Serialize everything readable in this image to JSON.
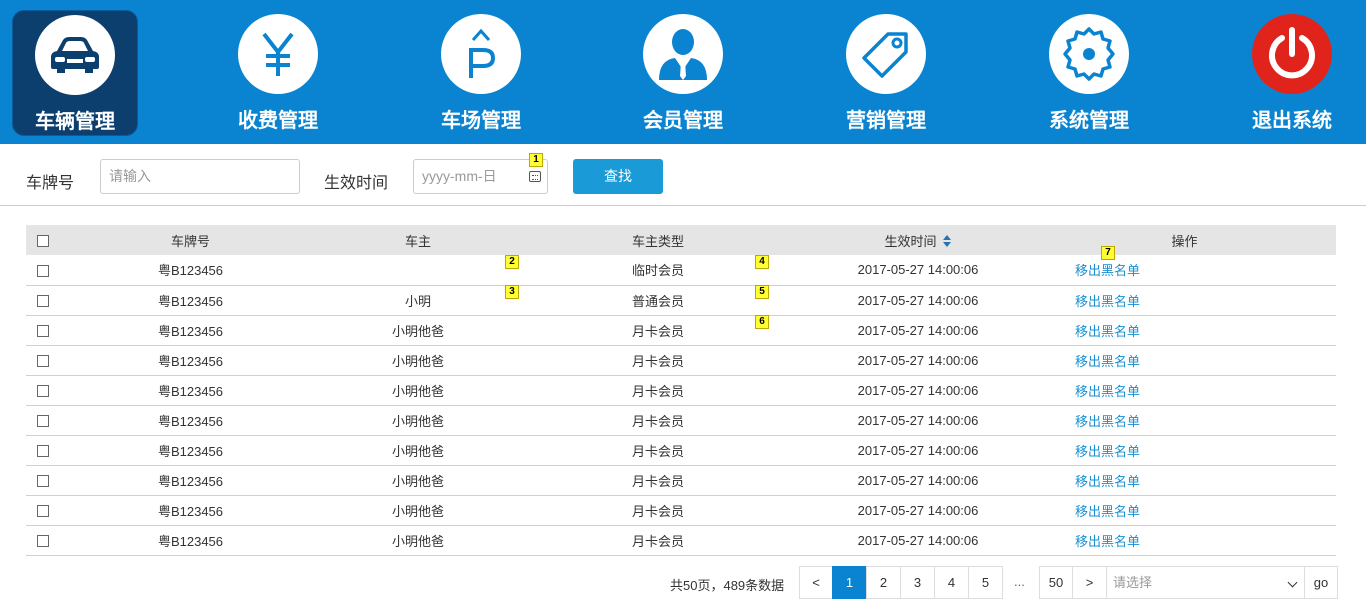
{
  "nav": {
    "items": [
      {
        "label": "车辆管理",
        "icon": "car-icon",
        "active": true
      },
      {
        "label": "收费管理",
        "icon": "yen-icon"
      },
      {
        "label": "车场管理",
        "icon": "parking-icon"
      },
      {
        "label": "会员管理",
        "icon": "member-icon"
      },
      {
        "label": "营销管理",
        "icon": "tag-icon"
      },
      {
        "label": "系统管理",
        "icon": "gear-icon"
      },
      {
        "label": "退出系统",
        "icon": "power-icon"
      }
    ],
    "colors": {
      "bar": "#0a84d0",
      "active": "#0c3f6e",
      "exit": "#e0241b"
    }
  },
  "search": {
    "plate_label": "车牌号",
    "plate_placeholder": "请输入",
    "date_label": "生效时间",
    "date_placeholder": "yyyy-mm-日",
    "button": "查找"
  },
  "table": {
    "headers": {
      "plate": "车牌号",
      "owner": "车主",
      "type": "车主类型",
      "time": "生效时间",
      "action": "操作"
    },
    "rows": [
      {
        "plate": "粤B123456",
        "owner": "",
        "type": "临时会员",
        "time": "2017-05-27 14:00:06",
        "action": "移出黑名单"
      },
      {
        "plate": "粤B123456",
        "owner": "小明",
        "type": "普通会员",
        "time": "2017-05-27 14:00:06",
        "action": "移出黑名单"
      },
      {
        "plate": "粤B123456",
        "owner": "小明他爸",
        "type": "月卡会员",
        "time": "2017-05-27 14:00:06",
        "action": "移出黑名单"
      },
      {
        "plate": "粤B123456",
        "owner": "小明他爸",
        "type": "月卡会员",
        "time": "2017-05-27 14:00:06",
        "action": "移出黑名单"
      },
      {
        "plate": "粤B123456",
        "owner": "小明他爸",
        "type": "月卡会员",
        "time": "2017-05-27 14:00:06",
        "action": "移出黑名单"
      },
      {
        "plate": "粤B123456",
        "owner": "小明他爸",
        "type": "月卡会员",
        "time": "2017-05-27 14:00:06",
        "action": "移出黑名单"
      },
      {
        "plate": "粤B123456",
        "owner": "小明他爸",
        "type": "月卡会员",
        "time": "2017-05-27 14:00:06",
        "action": "移出黑名单"
      },
      {
        "plate": "粤B123456",
        "owner": "小明他爸",
        "type": "月卡会员",
        "time": "2017-05-27 14:00:06",
        "action": "移出黑名单"
      },
      {
        "plate": "粤B123456",
        "owner": "小明他爸",
        "type": "月卡会员",
        "time": "2017-05-27 14:00:06",
        "action": "移出黑名单"
      },
      {
        "plate": "粤B123456",
        "owner": "小明他爸",
        "type": "月卡会员",
        "time": "2017-05-27 14:00:06",
        "action": "移出黑名单"
      }
    ]
  },
  "markers": [
    "1",
    "2",
    "3",
    "4",
    "5",
    "6",
    "7"
  ],
  "pagination": {
    "summary": "共50页，489条数据",
    "prev": "<",
    "pages": [
      "1",
      "2",
      "3",
      "4",
      "5"
    ],
    "current": "1",
    "ellipsis": "...",
    "last": "50",
    "next": ">",
    "select_placeholder": "请选择",
    "go": "go"
  }
}
